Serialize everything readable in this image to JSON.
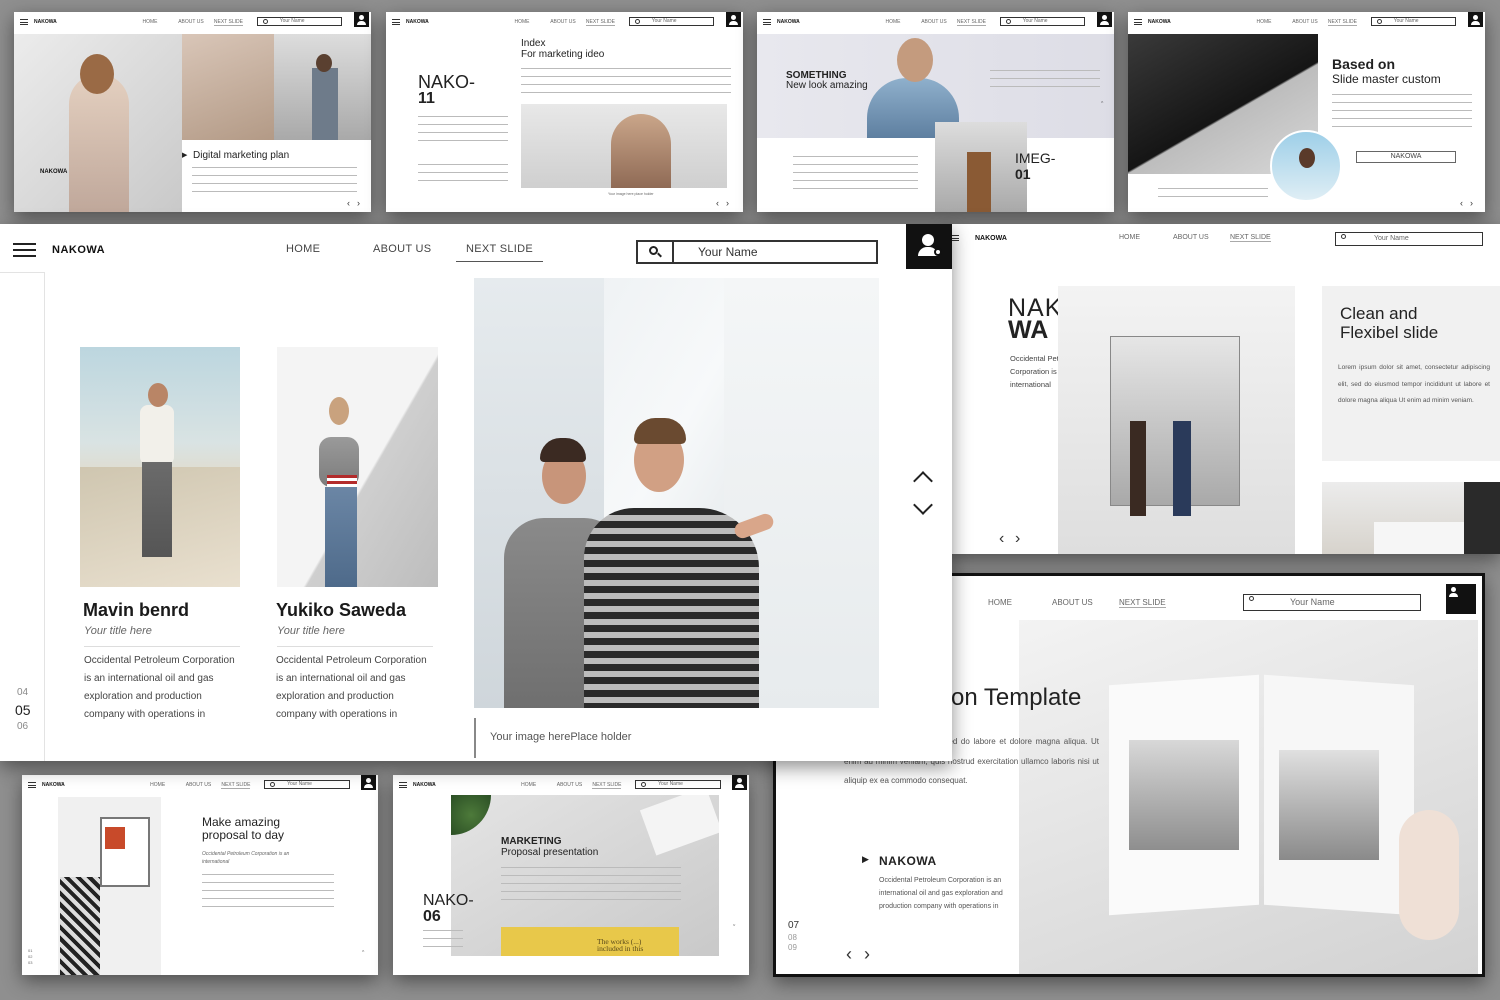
{
  "common": {
    "brand": "NAKOWA",
    "nav": [
      "HOME",
      "ABOUT US",
      "NEXT SLIDE"
    ],
    "search_placeholder": "Your Name"
  },
  "thumbs": {
    "t1": {
      "person": "NAKOWA",
      "heading": "Digital marketing plan"
    },
    "t2": {
      "title_line1": "Index",
      "title_line2": "For marketing ideo",
      "big1": "NAKO-",
      "big2": "11",
      "caption": "Your image here place holder"
    },
    "t3": {
      "heading1": "SOMETHING",
      "heading2": "New look amazing",
      "big1": "IMEG-",
      "big2": "01"
    },
    "t4": {
      "heading1": "Based on",
      "heading2": "Slide master custom",
      "button": "NAKOWA"
    },
    "t5": {
      "big1": "NAKO-",
      "big2": "WA",
      "side": "Occidental Petroleum Corporation is an international",
      "heading1": "Clean and",
      "heading2": "Flexibel slide",
      "body": "Lorem ipsum dolor sit amet, consectetur adipiscing elit, sed do eiusmod tempor incididunt ut labore et dolore magna aliqua Ut enim ad minim veniam."
    },
    "t6": {
      "heading": "on Template",
      "body": "consectetur adipiscing elit, sed do labore et dolore magna aliqua. Ut enim ad minim veniam, quis nostrud exercitation ullamco laboris nisi ut aliquip ex ea commodo consequat.",
      "name": "NAKOWA",
      "desc": "Occidental Petroleum Corporation is an international oil and gas exploration and production company with operations in",
      "pages": [
        "07",
        "08",
        "09"
      ]
    },
    "t7": {
      "heading1": "Make amazing",
      "heading2": "proposal to day",
      "sub": "Occidental Petroleum Corporation is an international",
      "pages": [
        "01",
        "02",
        "03"
      ]
    },
    "t8": {
      "heading1": "MARKETING",
      "heading2": "Proposal presentation",
      "big1": "NAKO-",
      "big2": "06",
      "book": "The works (...) included in this"
    }
  },
  "main": {
    "pages": [
      "04",
      "05",
      "06"
    ],
    "active_tab": "NEXT SLIDE",
    "people": [
      {
        "name": "Mavin benrd",
        "title": "Your title here",
        "desc_lines": [
          "Occidental Petroleum Corporation",
          "is an international oil and gas",
          "exploration and production",
          "company with operations in"
        ]
      },
      {
        "name": "Yukiko Saweda",
        "title": "Your title here",
        "desc_lines": [
          "Occidental Petroleum Corporation",
          "is an international oil and gas",
          "exploration and production",
          "company with operations in"
        ]
      }
    ],
    "caption": "Your image herePlace holder"
  },
  "icons": [
    "hamburger-menu-icon",
    "search-icon",
    "user-add-icon",
    "chevron-up-icon",
    "chevron-down-icon",
    "chevron-left-icon",
    "chevron-right-icon",
    "play-triangle-icon"
  ],
  "colors": {
    "background": "#8f8f8f",
    "slide": "#ffffff",
    "accent": "#111111"
  }
}
